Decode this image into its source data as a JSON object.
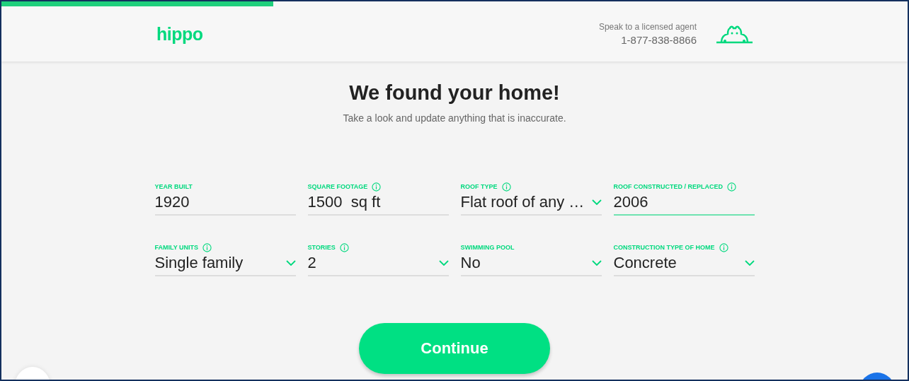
{
  "progress": {
    "level": 0.3
  },
  "header": {
    "logo": "hippo",
    "agent_label": "Speak to a licensed agent",
    "phone": "1-877-838-8866"
  },
  "title": "We found your home!",
  "subtitle": "Take a look and update anything that is inaccurate.",
  "fields": [
    {
      "label": "YEAR BUILT",
      "value": "1920",
      "kind": "text",
      "info": false,
      "focused": false
    },
    {
      "label": "SQUARE FOOTAGE",
      "value": "1500  sq ft",
      "kind": "text",
      "info": true,
      "focused": false
    },
    {
      "label": "ROOF TYPE",
      "value": "Flat roof of any …",
      "kind": "select",
      "info": true,
      "focused": false
    },
    {
      "label": "ROOF CONSTRUCTED / REPLACED",
      "value": "2006",
      "kind": "text",
      "info": true,
      "focused": true
    },
    {
      "label": "FAMILY UNITS",
      "value": "Single family",
      "kind": "select",
      "info": true,
      "focused": false
    },
    {
      "label": "STORIES",
      "value": "2",
      "kind": "select",
      "info": true,
      "focused": false
    },
    {
      "label": "SWIMMING POOL",
      "value": "No",
      "kind": "select",
      "info": false,
      "focused": false
    },
    {
      "label": "CONSTRUCTION TYPE OF HOME",
      "value": "Concrete",
      "kind": "select",
      "info": true,
      "focused": false
    }
  ],
  "continue_button": "Continue"
}
